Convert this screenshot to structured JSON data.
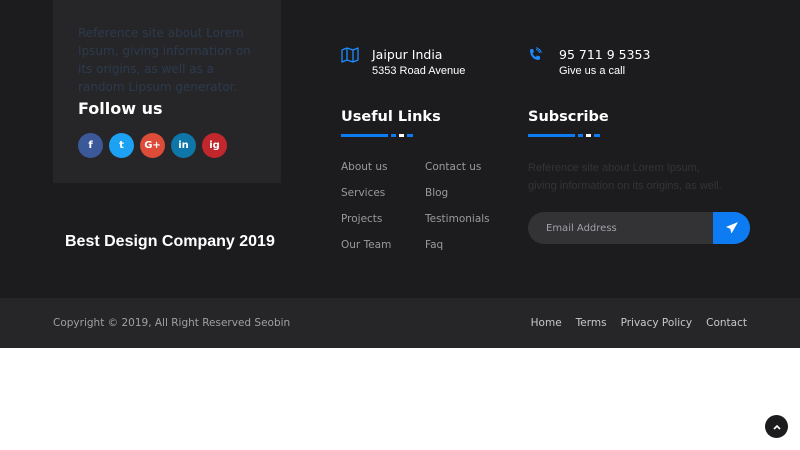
{
  "about": {
    "text": "Reference site about Lorem Ipsum, giving information on its origins, as well as a random Lipsum generator."
  },
  "follow": {
    "title": "Follow us",
    "socials": [
      {
        "name": "facebook-icon",
        "glyph": "f",
        "color": "#3b5998"
      },
      {
        "name": "twitter-icon",
        "glyph": "t",
        "color": "#1da1f2"
      },
      {
        "name": "google-plus-icon",
        "glyph": "G+",
        "color": "#dd4b39"
      },
      {
        "name": "linkedin-icon",
        "glyph": "in",
        "color": "#0e76a8"
      },
      {
        "name": "instagram-icon",
        "glyph": "ig",
        "color": "#c1272d"
      }
    ]
  },
  "tagline": "Best Design Company 2019",
  "contact": {
    "address_main": "Jaipur India",
    "address_sub": "5353 Road Avenue",
    "phone_main": "95 711 9 5353",
    "phone_sub": "Give us a call"
  },
  "useful_links": {
    "title": "Useful Links",
    "col1": [
      "About us",
      "Services",
      "Projects",
      "Our Team"
    ],
    "col2": [
      "Contact us",
      "Blog",
      "Testimonials",
      "Faq"
    ]
  },
  "subscribe": {
    "title": "Subscribe",
    "text": "Reference site about Lorem Ipsum, giving information on its origins, as well.",
    "email_placeholder": "Email Address"
  },
  "bottom": {
    "copyright": "Copyright © 2019, All Right Reserved Seobin",
    "nav": [
      "Home",
      "Terms",
      "Privacy Policy",
      "Contact"
    ]
  },
  "colors": {
    "accent": "#0d7cf2",
    "footer_bg": "#1c1c1e",
    "bar_bg": "#262628"
  }
}
